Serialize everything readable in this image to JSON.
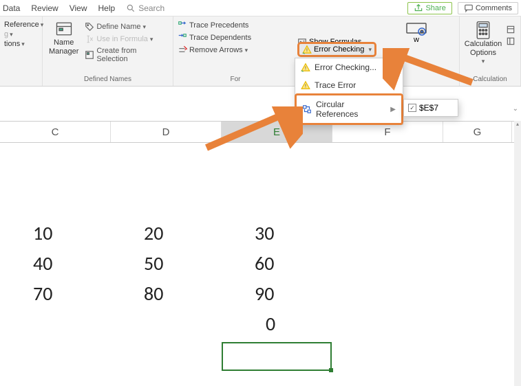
{
  "topbar": {
    "tabs": [
      "Data",
      "Review",
      "View",
      "Help"
    ],
    "search_placeholder": "Search",
    "share": "Share",
    "comments": "Comments"
  },
  "ribbon": {
    "left_group": {
      "items": [
        "Reference",
        "g",
        "tions"
      ]
    },
    "defined_names": {
      "label": "Defined Names",
      "name_manager": "Name\nManager",
      "define_name": "Define Name",
      "use_in_formula": "Use in Formula",
      "create_from_selection": "Create from Selection"
    },
    "formula_auditing": {
      "label_prefix": "For",
      "trace_precedents": "Trace Precedents",
      "trace_dependents": "Trace Dependents",
      "remove_arrows": "Remove Arrows",
      "show_formulas": "Show Formulas",
      "error_checking": "Error Checking"
    },
    "calculation": {
      "label": "Calculation",
      "options": "Calculation\nOptions",
      "w": "w"
    }
  },
  "dropdown": {
    "error_checking": "Error Checking...",
    "trace_error": "Trace Error",
    "circular_references": "Circular References"
  },
  "submenu_cell": "$E$7",
  "columns": [
    "C",
    "D",
    "E",
    "F",
    "G"
  ],
  "grid_data": [
    {
      "c": "10",
      "d": "20",
      "e": "30"
    },
    {
      "c": "40",
      "d": "50",
      "e": "60"
    },
    {
      "c": "70",
      "d": "80",
      "e": "90"
    },
    {
      "c": "",
      "d": "",
      "e": "0"
    }
  ]
}
